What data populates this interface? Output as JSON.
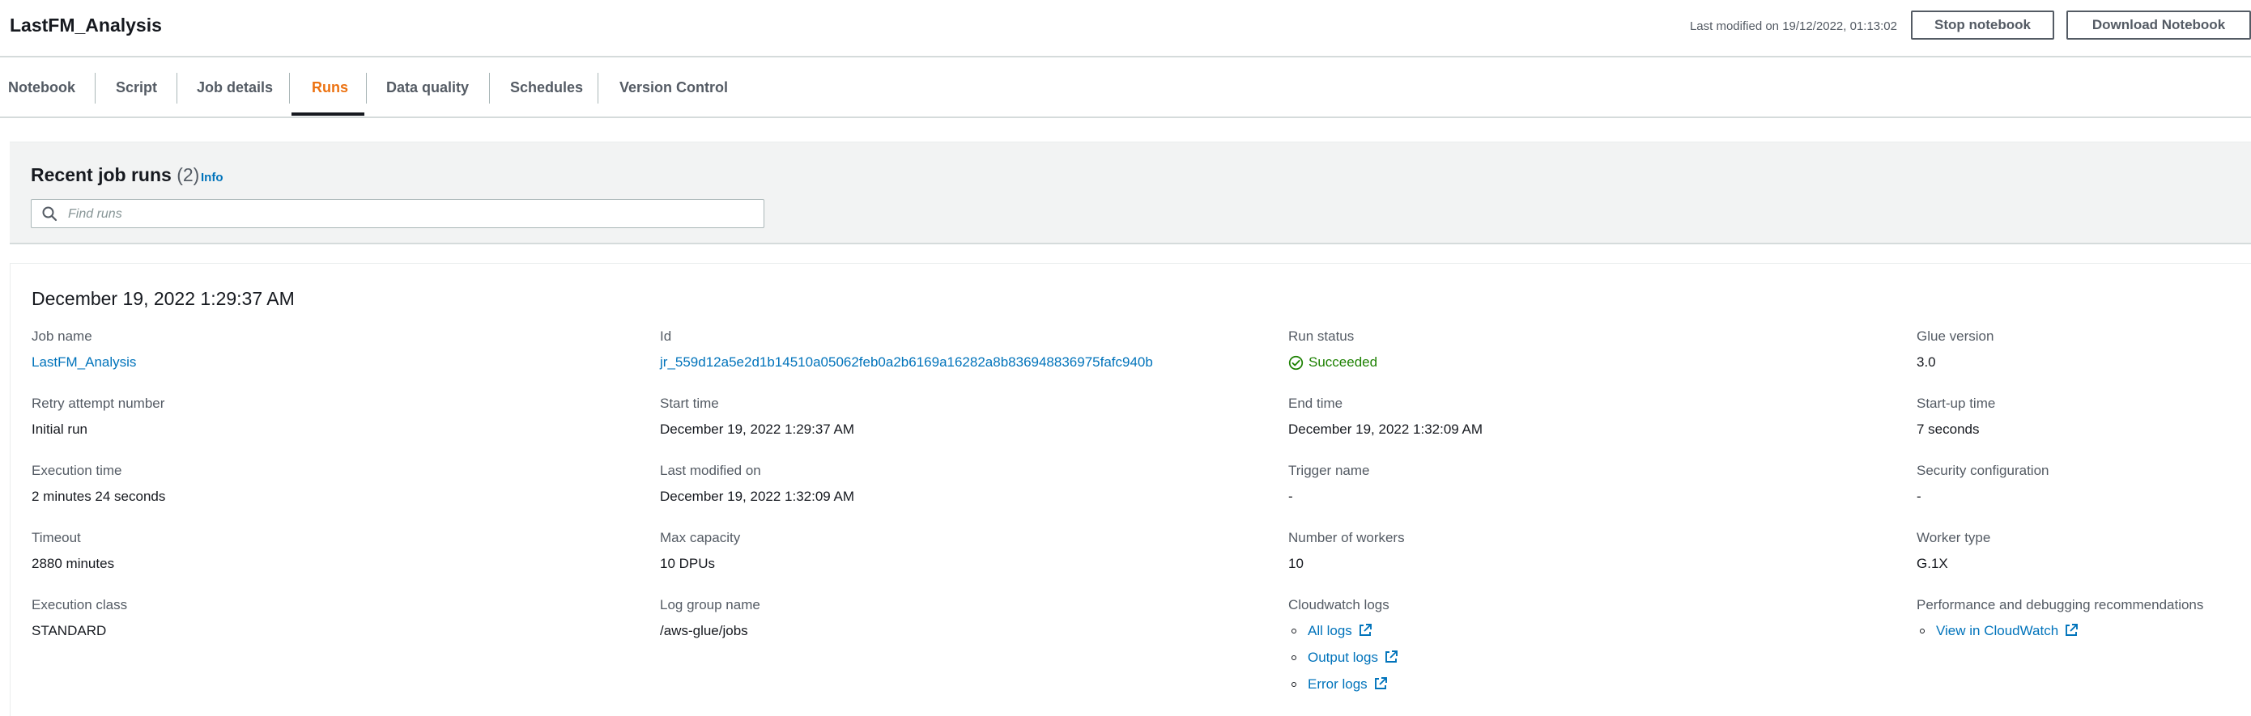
{
  "header": {
    "title": "LastFM_Analysis",
    "last_modified": "Last modified on 19/12/2022, 01:13:02",
    "stop_label": "Stop notebook",
    "download_label": "Download Notebook"
  },
  "tabs": [
    "Notebook",
    "Script",
    "Job details",
    "Runs",
    "Data quality",
    "Schedules",
    "Version Control"
  ],
  "active_tab": "Runs",
  "recent_runs": {
    "title": "Recent job runs",
    "count": "(2)",
    "info_label": "Info",
    "search_placeholder": "Find runs"
  },
  "run": {
    "title": "December 19, 2022 1:29:37 AM",
    "job_name": {
      "label": "Job name",
      "value": "LastFM_Analysis"
    },
    "retry": {
      "label": "Retry attempt number",
      "value": "Initial run"
    },
    "execution_time": {
      "label": "Execution time",
      "value": "2 minutes 24 seconds"
    },
    "timeout": {
      "label": "Timeout",
      "value": "2880 minutes"
    },
    "execution_class": {
      "label": "Execution class",
      "value": "STANDARD"
    },
    "id": {
      "label": "Id",
      "value": "jr_559d12a5e2d1b14510a05062feb0a2b6169a16282a8b836948836975fafc940b"
    },
    "start_time": {
      "label": "Start time",
      "value": "December 19, 2022 1:29:37 AM"
    },
    "last_modified_on": {
      "label": "Last modified on",
      "value": "December 19, 2022 1:32:09 AM"
    },
    "max_capacity": {
      "label": "Max capacity",
      "value": "10 DPUs"
    },
    "log_group": {
      "label": "Log group name",
      "value": "/aws-glue/jobs"
    },
    "run_status": {
      "label": "Run status",
      "value": "Succeeded",
      "color": "#1d8102"
    },
    "end_time": {
      "label": "End time",
      "value": "December 19, 2022 1:32:09 AM"
    },
    "trigger_name": {
      "label": "Trigger name",
      "value": "-"
    },
    "workers": {
      "label": "Number of workers",
      "value": "10"
    },
    "cloudwatch": {
      "label": "Cloudwatch logs",
      "links": [
        "All logs",
        "Output logs",
        "Error logs"
      ]
    },
    "glue_version": {
      "label": "Glue version",
      "value": "3.0"
    },
    "startup_time": {
      "label": "Start-up time",
      "value": "7 seconds"
    },
    "security_config": {
      "label": "Security configuration",
      "value": "-"
    },
    "worker_type": {
      "label": "Worker type",
      "value": "G.1X"
    },
    "perf": {
      "label": "Performance and debugging recommendations",
      "link": "View in CloudWatch"
    }
  },
  "colors": {
    "accent": "#ec7211",
    "link": "#0073bb",
    "success": "#1d8102"
  },
  "icons": [
    "search-icon",
    "success-check-icon",
    "external-link-icon"
  ]
}
